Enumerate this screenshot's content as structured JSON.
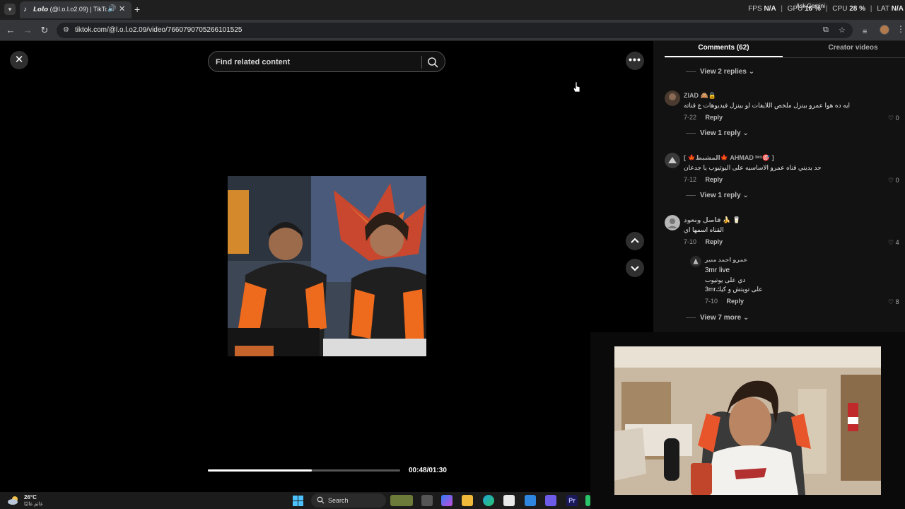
{
  "browser": {
    "tab_title": "𝙇𝙤𝙡𝙤 (@l.o.l.o2.09) | TikTok",
    "url": "tiktok.com/@l.o.l.o2.09/video/7660790705266101525",
    "overlay": {
      "fps_label": "FPS",
      "fps_value": "N/A",
      "gpu_label": "GPU",
      "gpu_value": "16 %",
      "cpu_label": "CPU",
      "cpu_value": "28 %",
      "lat_label": "LAT",
      "lat_value": "N/A"
    },
    "ask_gemini": "Ask Gemini"
  },
  "viewer": {
    "search_placeholder": "Find related content",
    "progress": 0.54,
    "time": "00:48/01:30"
  },
  "comments_panel": {
    "tab_comments": "Comments (62)",
    "tab_creator": "Creator videos",
    "top_view_replies": "View 2 replies",
    "comments": [
      {
        "user": "ZIAD 🙈🔒",
        "text": "ايه ده هوا عمرو بينزل ملخص اللايفات لو بينزل فيديوهات ع قناته",
        "date": "7-22",
        "reply": "Reply",
        "likes": "0",
        "view_replies": "View 1 reply"
      },
      {
        "user": "[ 🍁المشبط🍁 AHMAD ᵇʳᵒ🎯 ]",
        "text": "حد يديني قناه عمرو الاساسيه على اليوتيوب يا جدعان",
        "date": "7-12",
        "reply": "Reply",
        "likes": "0",
        "view_replies": "View 1 reply"
      },
      {
        "user": "فاصل ونعود 🍌 🥛",
        "text": "القناه اسمها اي",
        "date": "7-10",
        "reply": "Reply",
        "likes": "4",
        "view_replies": "View 7 more"
      }
    ],
    "nested_reply": {
      "user": "عمرو احمد منير",
      "line1": "3mr live",
      "line2": "دي على يوتيوب",
      "line3": "3mrعلى تويتش و كيك",
      "date": "7-10",
      "reply": "Reply",
      "likes": "8"
    }
  },
  "taskbar": {
    "temperature": "26°C",
    "weather": "غائم غالبًا",
    "search_label": "Search"
  }
}
